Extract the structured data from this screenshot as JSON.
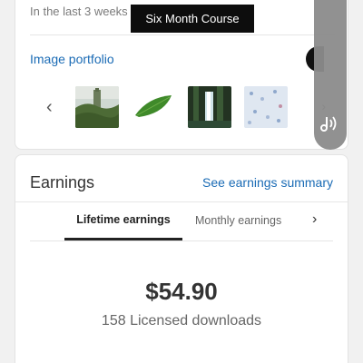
{
  "portfolio_card": {
    "period_text": "In the last 3 weeks",
    "banner_text": "Six Month Course",
    "portfolio_link": "Image portfolio",
    "prev_glyph": "‹",
    "next_glyph": "›",
    "thumbnails": [
      "tower-landscape",
      "green-leaf",
      "waterfall-forest",
      "blue-pattern"
    ]
  },
  "earnings": {
    "title": "Earnings",
    "summary_link": "See earnings summary",
    "tabs": [
      {
        "label": "Lifetime earnings",
        "active": true
      },
      {
        "label": "Monthly earnings",
        "active": false
      }
    ],
    "more_glyph": "›",
    "amount": "$54.90",
    "downloads": "158 Licensed downloads"
  },
  "colors": {
    "accent": "#1a6bb5",
    "text": "#333333",
    "banner": "#0d0d0d"
  }
}
